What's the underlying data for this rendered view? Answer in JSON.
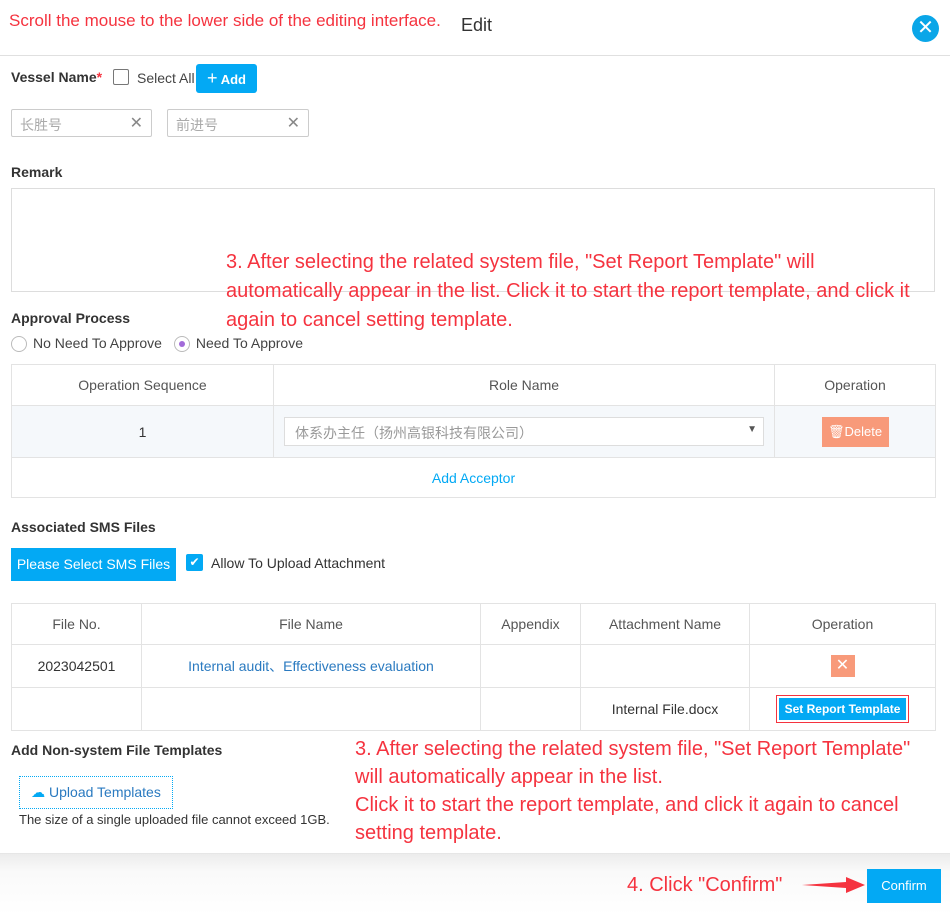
{
  "header": {
    "instruction": "Scroll the mouse to the lower side of the editing interface.",
    "title": "Edit",
    "close_icon": "close-circle-icon"
  },
  "vessel": {
    "label": "Vessel Name",
    "required": "*",
    "select_all": "Select All",
    "add_label": "Add",
    "tags": [
      "长胜号",
      "前进号"
    ]
  },
  "remark": {
    "label": "Remark",
    "value": ""
  },
  "annotation1": "3. After selecting the related system file, \"Set Report Template\" will automatically appear in the list. Click it to start the report template, and click it again to cancel setting template.",
  "approval": {
    "label": "Approval Process",
    "options": [
      "No Need To Approve",
      "Need To Approve"
    ],
    "selected": "Need To Approve",
    "columns": [
      "Operation Sequence",
      "Role Name",
      "Operation"
    ],
    "rows": [
      {
        "seq": "1",
        "role": "体系办主任（扬州高银科技有限公司）",
        "action": "Delete"
      }
    ],
    "add_label": "Add Acceptor"
  },
  "sms": {
    "label": "Associated SMS Files",
    "select_btn": "Please Select SMS Files",
    "allow_upload": "Allow To Upload Attachment",
    "allow_checked": true,
    "columns": [
      "File No.",
      "File Name",
      "Appendix",
      "Attachment Name",
      "Operation"
    ],
    "rows": [
      {
        "file_no": "2023042501",
        "file_name": "Internal audit、Effectiveness evaluation",
        "appendix": "",
        "attachment": ""
      },
      {
        "file_no": "",
        "file_name": "",
        "appendix": "",
        "attachment": "Internal File.docx",
        "action": "Set Report Template"
      }
    ]
  },
  "nonsystem": {
    "label": "Add Non-system File Templates",
    "upload_btn": "Upload Templates",
    "hint": "The size of a single uploaded file cannot exceed 1GB."
  },
  "annotation2": {
    "line1": "3. After selecting the related system file, \"Set Report Template\" will automatically appear in the list.",
    "line2": "Click it to start the report template, and click it again to cancel setting template."
  },
  "footer": {
    "annotation": "4. Click \"Confirm\"",
    "confirm": "Confirm"
  },
  "colors": {
    "accent": "#03a9f4",
    "danger": "#f89a7a",
    "annotation": "#f5333f"
  }
}
